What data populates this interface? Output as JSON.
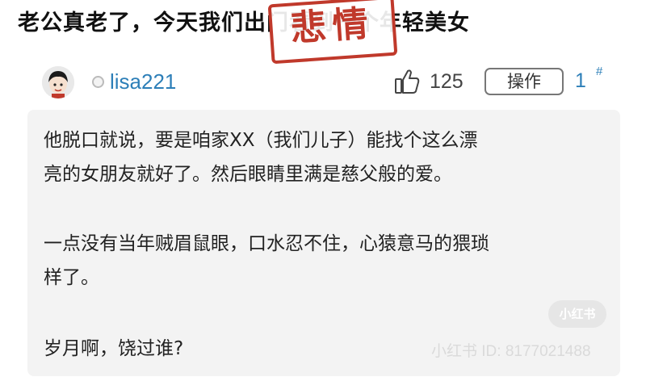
{
  "post": {
    "title": "老公真老了，今天我们出门看到一个年轻美女",
    "stamp_text": "悲情"
  },
  "reply": {
    "avatar_icon": "cartoon-face-avatar",
    "online_icon": "offline-status-dot",
    "username": "lisa221",
    "like_icon": "thumbs-up-icon",
    "like_count": "125",
    "action_label": "操作",
    "floor_number": "1",
    "floor_suffix": "#",
    "paragraphs": [
      "他脱口就说，要是咱家XX（我们儿子）能找个这么漂",
      "亮的女朋友就好了。然后眼睛里满是慈父般的爱。",
      "一点没有当年贼眉鼠眼，口水忍不住，心猿意马的猥琐",
      "样了。",
      "岁月啊，饶过谁?"
    ]
  },
  "watermark": {
    "logo_text": "小红书",
    "id_text": "小红书 ID: 8177021488"
  },
  "colors": {
    "link_blue": "#2d7fb8",
    "stamp_red": "#c0392b",
    "content_bg": "#f3f3f3"
  }
}
